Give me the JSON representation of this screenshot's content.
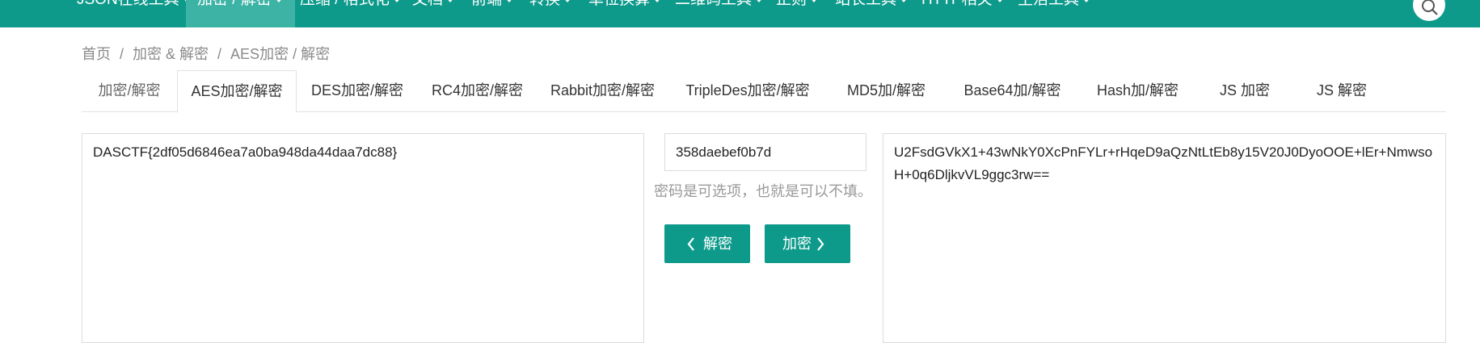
{
  "nav": {
    "items": [
      {
        "label": "JSON在线工具",
        "caret": true,
        "active": false
      },
      {
        "label": "加密 / 解密",
        "caret": true,
        "active": true
      },
      {
        "label": "压缩 / 格式化",
        "caret": true,
        "active": false
      },
      {
        "label": "文档",
        "caret": true,
        "active": false
      },
      {
        "label": "前端",
        "caret": true,
        "active": false
      },
      {
        "label": "转换",
        "caret": true,
        "active": false
      },
      {
        "label": "单位换算",
        "caret": true,
        "active": false
      },
      {
        "label": "二维码工具",
        "caret": true,
        "active": false
      },
      {
        "label": "正则",
        "caret": true,
        "active": false
      },
      {
        "label": "站长工具",
        "caret": true,
        "active": false
      },
      {
        "label": "HTTP相关",
        "caret": true,
        "active": false
      },
      {
        "label": "生活工具",
        "caret": true,
        "active": false
      }
    ],
    "search_icon": "search-icon"
  },
  "breadcrumb": {
    "items": [
      "首页",
      "加密 & 解密",
      "AES加密 / 解密"
    ],
    "separator": "/"
  },
  "tabs": [
    {
      "label": "加密/解密",
      "active": false
    },
    {
      "label": "AES加密/解密",
      "active": true
    },
    {
      "label": "DES加密/解密",
      "active": false
    },
    {
      "label": "RC4加密/解密",
      "active": false
    },
    {
      "label": "Rabbit加密/解密",
      "active": false
    },
    {
      "label": "TripleDes加密/解密",
      "active": false
    },
    {
      "label": "MD5加/解密",
      "active": false
    },
    {
      "label": "Base64加/解密",
      "active": false
    },
    {
      "label": "Hash加/解密",
      "active": false
    },
    {
      "label": "JS 加密",
      "active": false
    },
    {
      "label": "JS 解密",
      "active": false
    }
  ],
  "plaintext": "DASCTF{2df05d6846ea7a0ba948da44daa7dc88}",
  "key": {
    "value": "358daebef0b7d",
    "hint": "密码是可选项，也就是可以不填。"
  },
  "buttons": {
    "decrypt_label": "解密",
    "encrypt_label": "加密"
  },
  "ciphertext": "U2FsdGVkX1+43wNkY0XcPnFYLr+rHqeD9aQzNtLtEb8y15V20J0DyoOOE+lEr+NmwsoH+0q6DljkvVL9ggc3rw==",
  "colors": {
    "accent": "#0e9a8b",
    "nav_active": "#3db3a6"
  }
}
